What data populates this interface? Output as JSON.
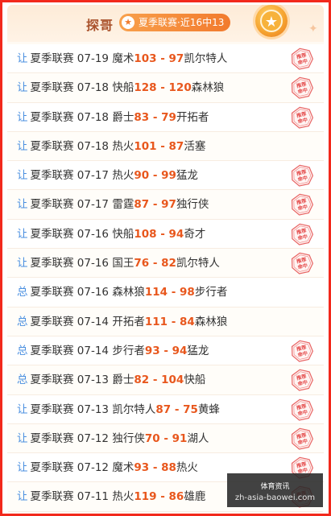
{
  "header": {
    "title": "探哥",
    "record": "夏季联赛·近16中13"
  },
  "stamp_text": "推荐命中",
  "rows": [
    {
      "tag": "让",
      "league": "夏季联赛",
      "date": "07-19",
      "home": "魔术",
      "home_score": "103",
      "away_score": "97",
      "away": "凯尔特人",
      "hit": true
    },
    {
      "tag": "让",
      "league": "夏季联赛",
      "date": "07-18",
      "home": "快船",
      "home_score": "128",
      "away_score": "120",
      "away": "森林狼",
      "hit": true
    },
    {
      "tag": "让",
      "league": "夏季联赛",
      "date": "07-18",
      "home": "爵士",
      "home_score": "83",
      "away_score": "79",
      "away": "开拓者",
      "hit": true
    },
    {
      "tag": "让",
      "league": "夏季联赛",
      "date": "07-18",
      "home": "热火",
      "home_score": "101",
      "away_score": "87",
      "away": "活塞",
      "hit": false
    },
    {
      "tag": "让",
      "league": "夏季联赛",
      "date": "07-17",
      "home": "热火",
      "home_score": "90",
      "away_score": "99",
      "away": "猛龙",
      "hit": true
    },
    {
      "tag": "让",
      "league": "夏季联赛",
      "date": "07-17",
      "home": "雷霆",
      "home_score": "87",
      "away_score": "97",
      "away": "独行侠",
      "hit": true
    },
    {
      "tag": "让",
      "league": "夏季联赛",
      "date": "07-16",
      "home": "快船",
      "home_score": "108",
      "away_score": "94",
      "away": "奇才",
      "hit": true
    },
    {
      "tag": "让",
      "league": "夏季联赛",
      "date": "07-16",
      "home": "国王",
      "home_score": "76",
      "away_score": "82",
      "away": "凯尔特人",
      "hit": true
    },
    {
      "tag": "总",
      "league": "夏季联赛",
      "date": "07-16",
      "home": "森林狼",
      "home_score": "114",
      "away_score": "98",
      "away": "步行者",
      "hit": false
    },
    {
      "tag": "总",
      "league": "夏季联赛",
      "date": "07-14",
      "home": "开拓者",
      "home_score": "111",
      "away_score": "84",
      "away": "森林狼",
      "hit": false
    },
    {
      "tag": "总",
      "league": "夏季联赛",
      "date": "07-14",
      "home": "步行者",
      "home_score": "93",
      "away_score": "94",
      "away": "猛龙",
      "hit": true
    },
    {
      "tag": "总",
      "league": "夏季联赛",
      "date": "07-13",
      "home": "爵士",
      "home_score": "82",
      "away_score": "104",
      "away": "快船",
      "hit": true
    },
    {
      "tag": "让",
      "league": "夏季联赛",
      "date": "07-13",
      "home": "凯尔特人",
      "home_score": "87",
      "away_score": "75",
      "away": "黄蜂",
      "hit": true
    },
    {
      "tag": "让",
      "league": "夏季联赛",
      "date": "07-12",
      "home": "独行侠",
      "home_score": "70",
      "away_score": "91",
      "away": "湖人",
      "hit": true
    },
    {
      "tag": "让",
      "league": "夏季联赛",
      "date": "07-12",
      "home": "魔术",
      "home_score": "93",
      "away_score": "88",
      "away": "热火",
      "hit": true
    },
    {
      "tag": "让",
      "league": "夏季联赛",
      "date": "07-11",
      "home": "热火",
      "home_score": "119",
      "away_score": "86",
      "away": "雄鹿",
      "hit": true
    }
  ],
  "watermark": {
    "line1": "体育资讯",
    "line2": "zh-asia-baowei.com"
  },
  "colors": {
    "border": "#f2291c",
    "score": "#e8571d",
    "tag": "#4a8fe0",
    "stamp": "#e44a4a"
  }
}
